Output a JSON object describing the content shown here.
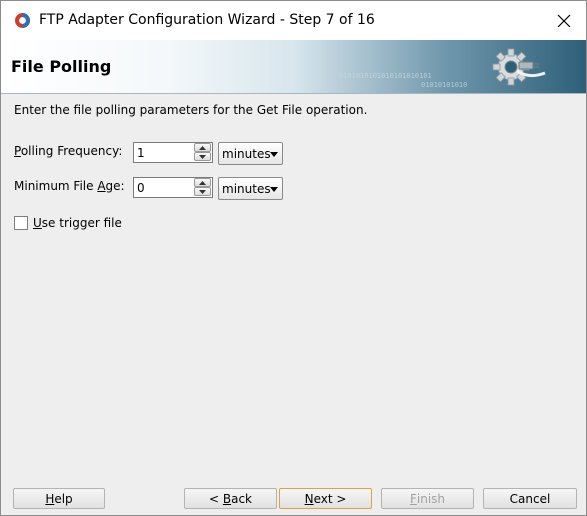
{
  "window": {
    "title": "FTP Adapter Configuration Wizard - Step 7 of 16",
    "close_glyph": "✕"
  },
  "header": {
    "title": "File Polling",
    "binary_line1": "0101010101010101010101",
    "binary_line2": "01010101010"
  },
  "instructions": "Enter the file polling parameters for the Get File operation.",
  "polling_frequency": {
    "label_mnemonic": "P",
    "label_rest": "olling Frequency:",
    "value": "1",
    "unit": "minutes"
  },
  "minimum_file_age": {
    "label_before": "Minimum File ",
    "label_mnemonic": "A",
    "label_after": "ge:",
    "value": "0",
    "unit": "minutes"
  },
  "trigger": {
    "label_mnemonic": "U",
    "label_rest": "se trigger file",
    "checked": false
  },
  "buttons": {
    "help_mnemonic": "H",
    "help_rest": "elp",
    "back_prefix": "< ",
    "back_mnemonic": "B",
    "back_rest": "ack",
    "next_mnemonic": "N",
    "next_rest": "ext >",
    "finish_mnemonic": "F",
    "finish_rest": "inish",
    "cancel": "Cancel"
  },
  "icons": {
    "app": "oracle-logo-icon",
    "close": "close-icon",
    "header": "gear-plug-icon",
    "spin_up": "spin-up-icon",
    "spin_down": "spin-down-icon",
    "dropdown": "chevron-down-icon"
  },
  "colors": {
    "header_dark": "#2e5f79",
    "default_button_border": "#e2a040"
  }
}
